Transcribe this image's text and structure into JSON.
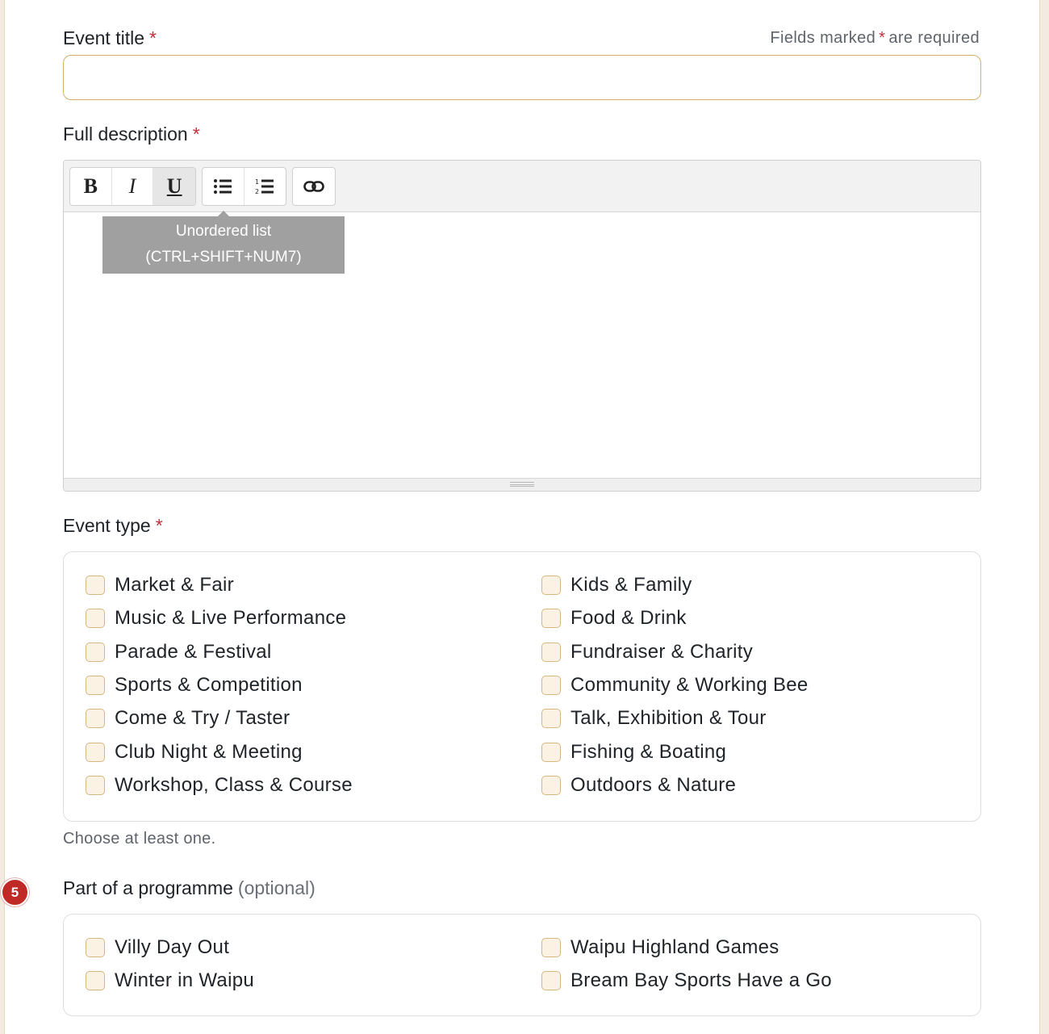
{
  "form": {
    "event_title": {
      "label": "Event title",
      "required_mark": "*",
      "value": "",
      "placeholder": ""
    },
    "required_note": {
      "prefix": "Fields marked",
      "mark": "*",
      "suffix": "are required"
    },
    "description": {
      "label": "Full description",
      "required_mark": "*",
      "toolbar": {
        "bold": "B",
        "italic": "I",
        "underline": "U",
        "unordered_list_icon": "list-bullet-icon",
        "ordered_list_icon": "list-numbered-icon",
        "link_icon": "link-icon"
      },
      "tooltip": {
        "line1": "Unordered list",
        "line2": "(CTRL+SHIFT+NUM7)"
      },
      "value": ""
    },
    "event_type": {
      "label": "Event type",
      "required_mark": "*",
      "left": [
        "Market & Fair",
        "Music & Live Performance",
        "Parade & Festival",
        "Sports & Competition",
        "Come & Try / Taster",
        "Club Night & Meeting",
        "Workshop, Class & Course"
      ],
      "right": [
        "Kids & Family",
        "Food & Drink",
        "Fundraiser & Charity",
        "Community & Working Bee",
        "Talk, Exhibition & Tour",
        "Fishing & Boating",
        "Outdoors & Nature"
      ],
      "help": "Choose at least one."
    },
    "programme": {
      "label": "Part of a programme",
      "optional": "(optional)",
      "step_number": "5",
      "left": [
        "Villy Day Out",
        "Winter in Waipu"
      ],
      "right": [
        "Waipu Highland Games",
        "Bream Bay Sports Have a Go"
      ]
    }
  },
  "colors": {
    "required": "#c0303a",
    "checkbox_fill": "#fbf2e3",
    "checkbox_border": "#d6b782",
    "input_border": "#d1b06c",
    "badge": "#c02a26"
  }
}
